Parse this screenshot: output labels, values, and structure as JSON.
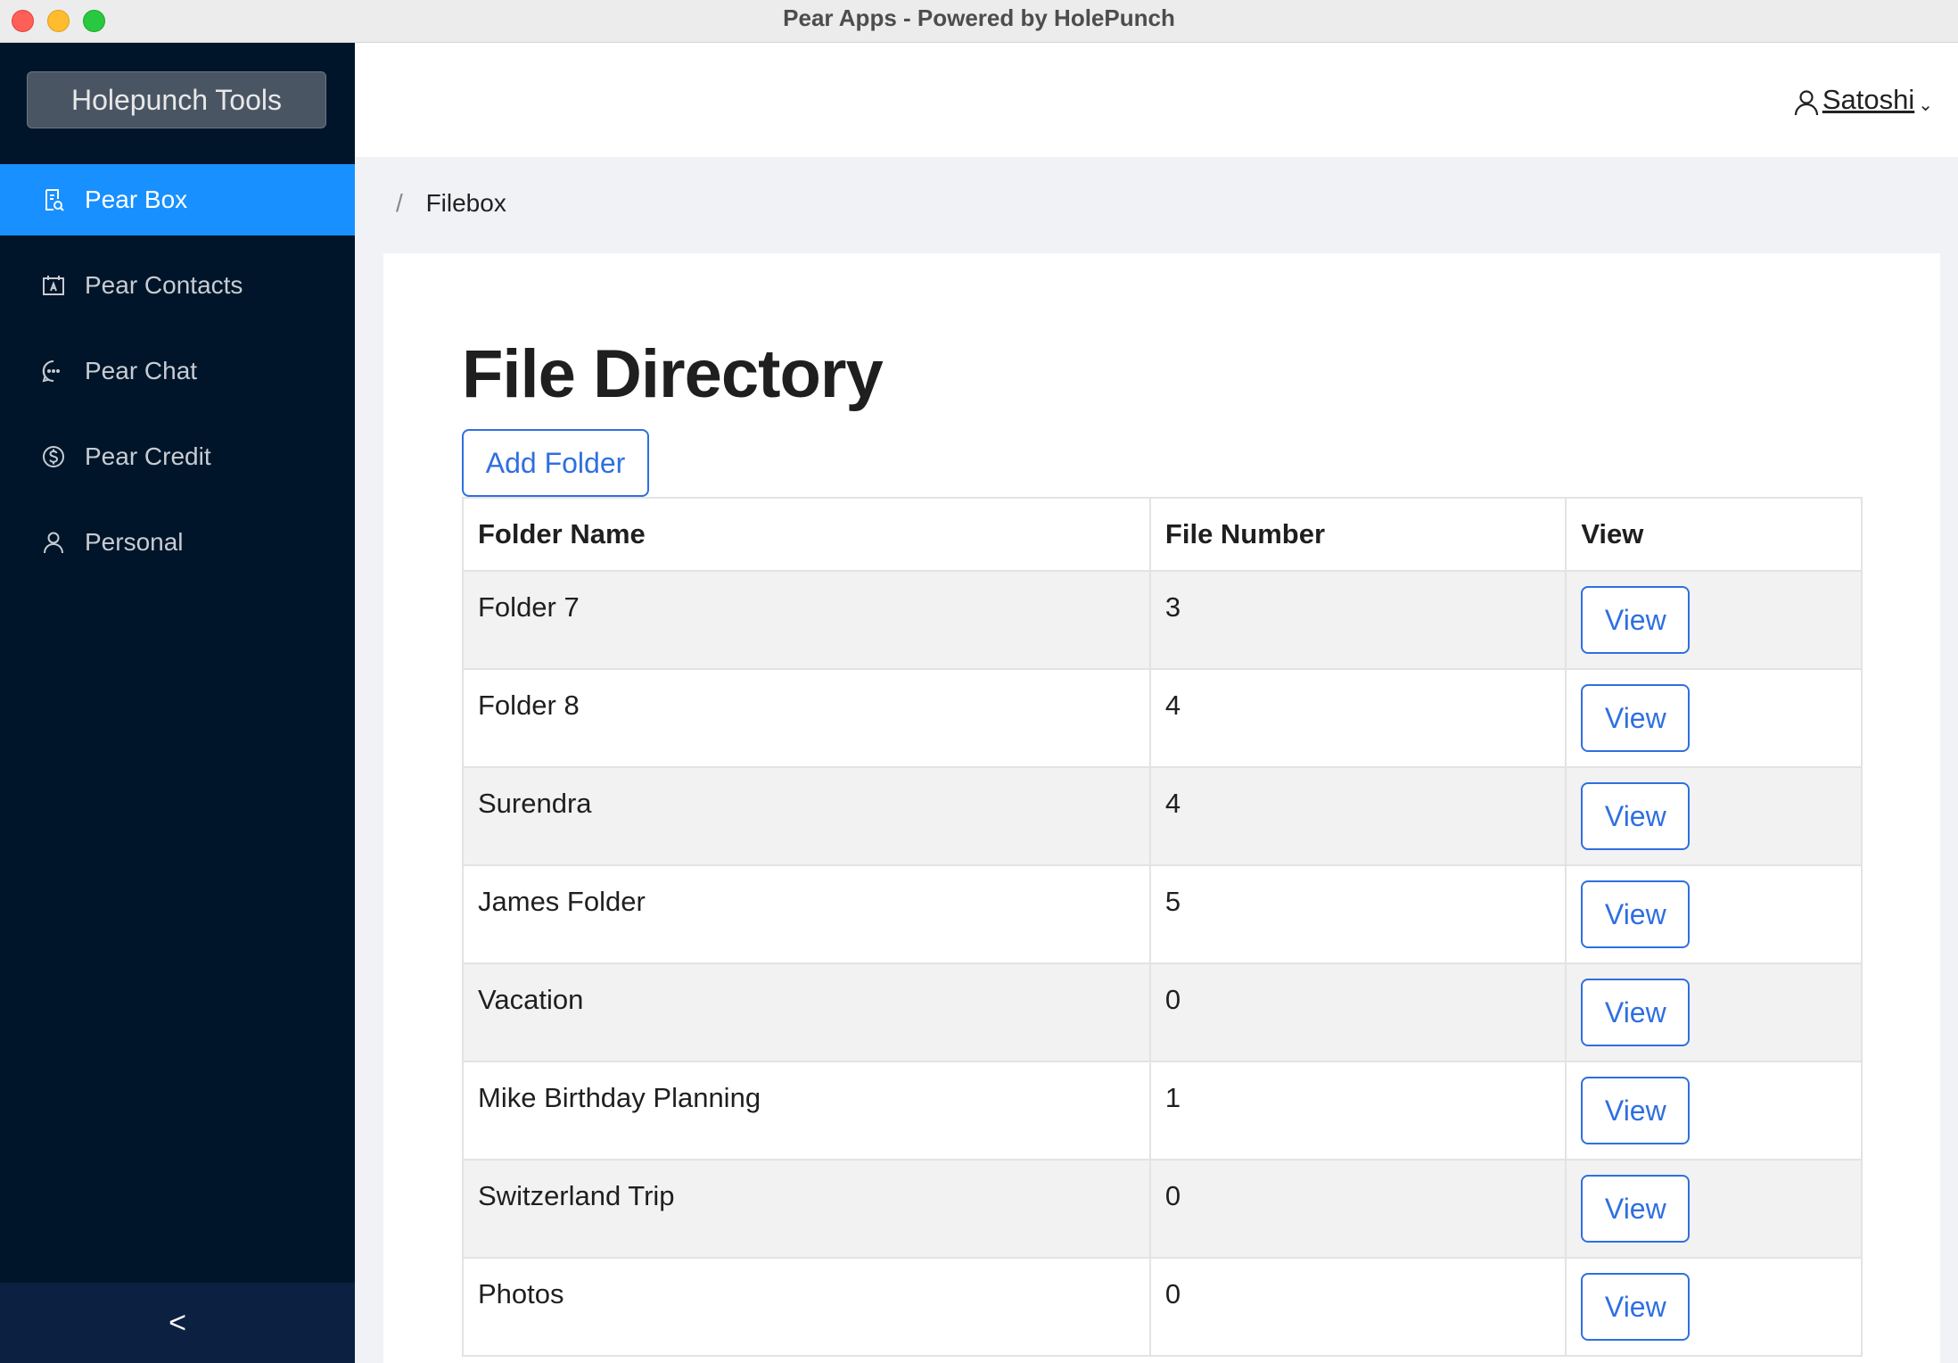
{
  "window": {
    "title": "Pear Apps - Powered by HolePunch"
  },
  "sidebar": {
    "logo": "Holepunch Tools",
    "items": [
      {
        "label": "Pear Box",
        "icon": "file-search-icon",
        "active": true
      },
      {
        "label": "Pear Contacts",
        "icon": "contacts-calendar-icon",
        "active": false
      },
      {
        "label": "Pear Chat",
        "icon": "chat-bubble-icon",
        "active": false
      },
      {
        "label": "Pear Credit",
        "icon": "dollar-circle-icon",
        "active": false
      },
      {
        "label": "Personal",
        "icon": "user-icon",
        "active": false
      }
    ],
    "collapse_label": "<"
  },
  "header": {
    "user_name": "Satoshi"
  },
  "breadcrumb": {
    "separator": "/",
    "current": "Filebox"
  },
  "main": {
    "title": "File Directory",
    "add_folder_label": "Add Folder",
    "table": {
      "headers": [
        "Folder Name",
        "File Number",
        "View"
      ],
      "view_label": "View",
      "rows": [
        {
          "name": "Folder 7",
          "count": "3"
        },
        {
          "name": "Folder 8",
          "count": "4"
        },
        {
          "name": "Surendra",
          "count": "4"
        },
        {
          "name": "James Folder",
          "count": "5"
        },
        {
          "name": "Vacation",
          "count": "0"
        },
        {
          "name": "Mike Birthday Planning",
          "count": "1"
        },
        {
          "name": "Switzerland Trip",
          "count": "0"
        },
        {
          "name": "Photos",
          "count": "0"
        }
      ]
    }
  },
  "colors": {
    "sidebar_bg": "#001529",
    "active_item": "#1890ff",
    "primary": "#2f6fe0",
    "stripe": "#f2f2f2"
  }
}
